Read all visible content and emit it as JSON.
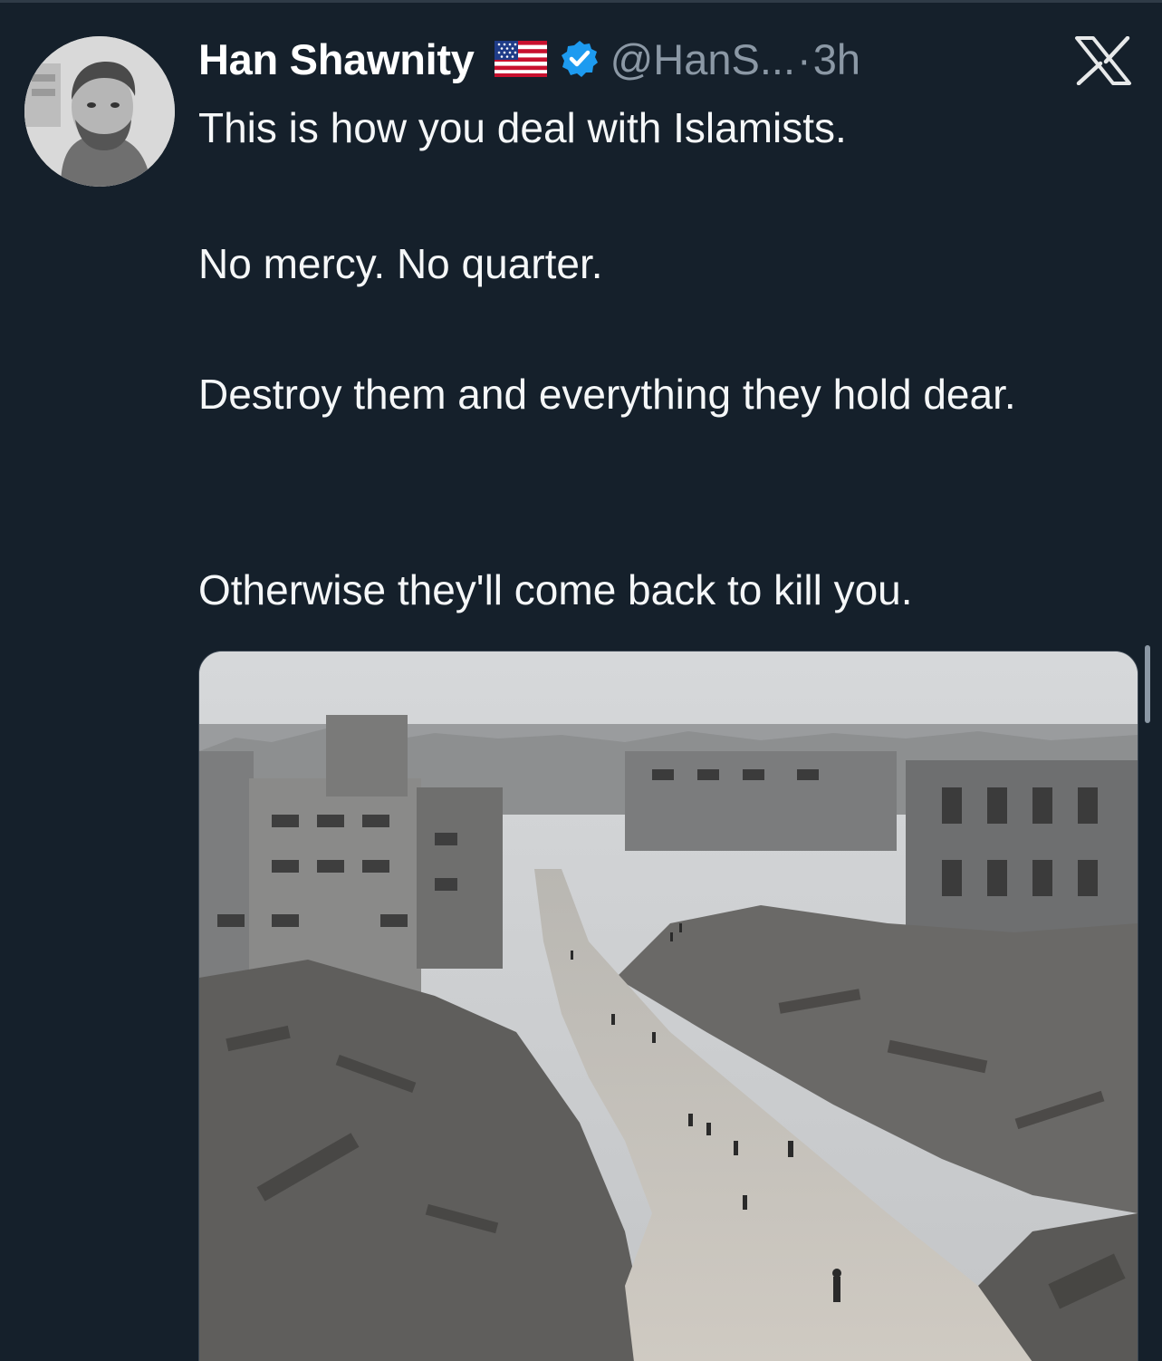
{
  "author": {
    "display_name": "Han Shawnity",
    "handle": "@HanS...",
    "separator": "·",
    "time": "3h",
    "flag_icon": "us-flag-icon",
    "verified_icon": "verified-badge-icon",
    "verified_color": "#1d9bf0"
  },
  "platform": {
    "logo_icon": "x-logo-icon"
  },
  "tweet": {
    "paragraphs": [
      "This is how you deal with Islamists.",
      "No mercy. No quarter.",
      "Destroy them and everything they hold dear.",
      "Otherwise they'll come back to kill you."
    ]
  },
  "media": {
    "type": "photo"
  },
  "colors": {
    "background": "#15202b",
    "text": "#e7e9ea",
    "secondary_text": "#8b98a5"
  }
}
